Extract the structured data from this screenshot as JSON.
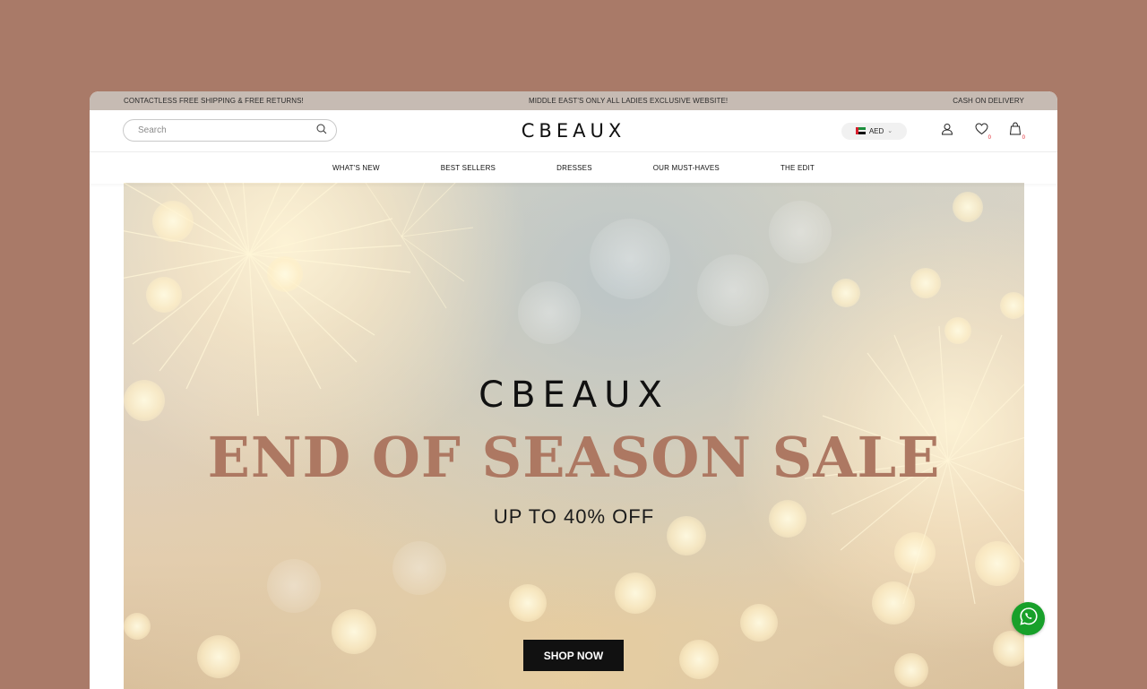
{
  "topbar": {
    "left": "CONTACTLESS FREE SHIPPING & FREE RETURNS!",
    "center": "MIDDLE EAST'S ONLY ALL LADIES EXCLUSIVE WEBSITE!",
    "right": "CASH ON DELIVERY"
  },
  "header": {
    "search_placeholder": "Search",
    "logo": "CBEAUX",
    "currency": "AED",
    "wishlist_count": "0",
    "cart_count": "0"
  },
  "nav": {
    "items": [
      "WHAT'S NEW",
      "BEST SELLERS",
      "DRESSES",
      "OUR MUST-HAVES",
      "THE EDIT"
    ]
  },
  "hero": {
    "brand": "CBEAUX",
    "title": "END OF SEASON SALE",
    "subtitle": "UP TO 40% OFF",
    "cta": "SHOP NOW"
  },
  "colors": {
    "page_bg": "#a97a68",
    "topbar_bg": "#c6bbb3",
    "hero_title": "#ad7862",
    "badge": "#e0262d",
    "whatsapp": "#18a02a"
  },
  "icons": [
    "search-icon",
    "user-icon",
    "heart-icon",
    "bag-icon",
    "whatsapp-icon",
    "chevron-down-icon",
    "uae-flag-icon"
  ]
}
